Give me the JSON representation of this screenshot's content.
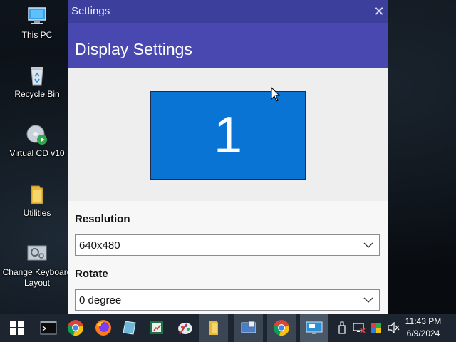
{
  "desktop": {
    "icons": [
      {
        "label": "This PC",
        "icon": "computer-icon"
      },
      {
        "label": "Recycle Bin",
        "icon": "recycle-bin-icon"
      },
      {
        "label": "Virtual CD v10",
        "icon": "cd-icon"
      },
      {
        "label": "Utilities",
        "icon": "folder-icon"
      },
      {
        "label": "Change Keyboard Layout",
        "line1": "Change Keyboard",
        "line2": "Layout",
        "icon": "keyboard-settings-icon"
      }
    ]
  },
  "window": {
    "title": "Settings",
    "close_glyph": "✕",
    "heading": "Display Settings",
    "monitor_number": "1",
    "resolution": {
      "label": "Resolution",
      "value": "640x480"
    },
    "rotate": {
      "label": "Rotate",
      "value": "0 degree"
    }
  },
  "taskbar": {
    "time": "11:43 PM",
    "date": "6/9/2024",
    "items": [
      "start-icon",
      "terminal-icon",
      "chrome-icon",
      "firefox-icon",
      "notepad-icon",
      "excel-icon",
      "paint-icon",
      "folder-icon",
      "remote-desktop-icon",
      "chrome-icon",
      "display-settings-icon"
    ]
  },
  "colors": {
    "titlebar": "#3c3f9c",
    "header": "#4848b0",
    "monitor": "#0a74d4",
    "taskbar": "#1c2530"
  }
}
